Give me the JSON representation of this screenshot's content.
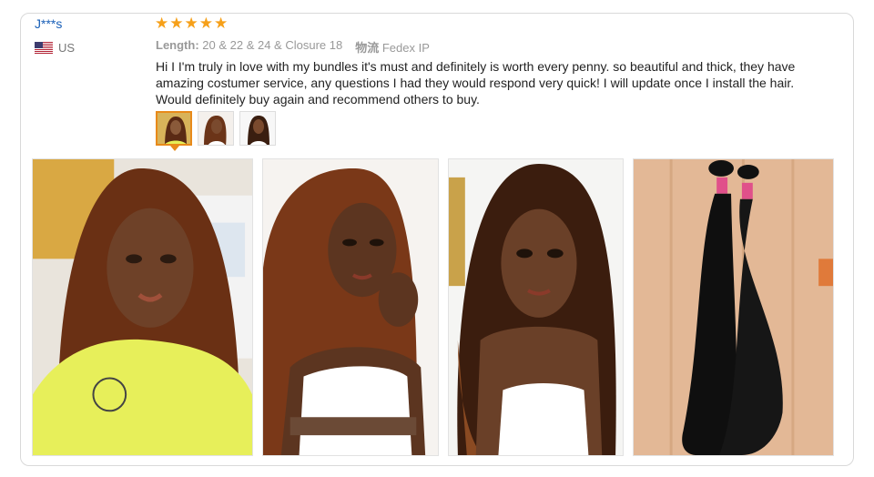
{
  "reviewer": {
    "name": "J***s",
    "country": "US",
    "flag_icon": "us-flag-icon"
  },
  "rating": {
    "stars": 5,
    "max": 5,
    "color": "#f6a019"
  },
  "order_info": {
    "length_label": "Length:",
    "length_value": "20 & 22 & 24 & Closure 18",
    "shipping_label": "物流",
    "shipping_value": "Fedex IP"
  },
  "review_text": "Hi I I'm truly in love with my bundles it's must and definitely is worth every penny. so beautiful and thick, they have amazing costumer service, any questions I had they would respond very quick! I will update once I install the hair. Would definitely buy again and recommend others to buy.",
  "thumbnails": [
    "photo-1",
    "photo-2",
    "photo-3"
  ],
  "selected_thumbnail": 0,
  "photos": [
    "selfie-yellow-shirt",
    "selfie-hand-on-chin",
    "selfie-white-top",
    "hair-bundles"
  ],
  "colors": {
    "name_link": "#1a60b8",
    "active_border": "#e88a1a"
  }
}
